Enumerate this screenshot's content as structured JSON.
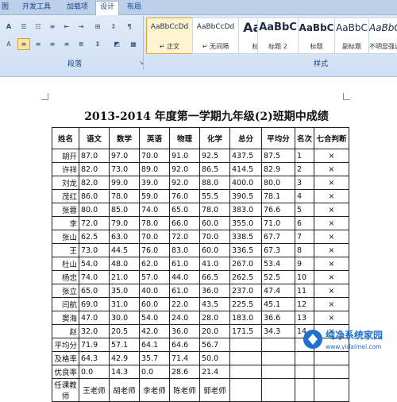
{
  "ribbon": {
    "tabs": [
      "图",
      "开发工具",
      "加载项",
      "设计",
      "布局"
    ],
    "active_tab": "设计",
    "groups": {
      "paragraph": "段落",
      "styles": "样式"
    },
    "styles": [
      {
        "sample": "AaBbCcDd",
        "name": "↵ 正文",
        "selected": true
      },
      {
        "sample": "AaBbCcDd",
        "name": "↵ 无间隔",
        "selected": false
      },
      {
        "sample": "AaBb",
        "name": "标题 1",
        "selected": false
      },
      {
        "sample": "AaBbC",
        "name": "标题 2",
        "selected": false
      },
      {
        "sample": "AaBbC",
        "name": "标题",
        "selected": false
      },
      {
        "sample": "AaBbC",
        "name": "副标题",
        "selected": false
      },
      {
        "sample": "AaBbC",
        "name": "不明显强调",
        "selected": false
      }
    ]
  },
  "document": {
    "title": "2013-2014 年度第一学期九年级(2)班期中成绩",
    "headers": [
      "姓名",
      "语文",
      "数学",
      "英语",
      "物理",
      "化学",
      "总分",
      "平均分",
      "名次",
      "七合判断"
    ],
    "rows": [
      [
        "胡开",
        "87.0",
        "97.0",
        "70.0",
        "91.0",
        "92.5",
        "437.5",
        "87.5",
        "1",
        "×"
      ],
      [
        "许祥",
        "82.0",
        "73.0",
        "89.0",
        "92.0",
        "86.5",
        "414.5",
        "82.9",
        "2",
        "×"
      ],
      [
        "刘龙",
        "82.0",
        "99.0",
        "39.0",
        "92.0",
        "88.0",
        "400.0",
        "80.0",
        "3",
        "×"
      ],
      [
        "茂红",
        "86.0",
        "78.0",
        "59.0",
        "76.0",
        "55.5",
        "390.5",
        "78.1",
        "4",
        "×"
      ],
      [
        "张蓉",
        "80.0",
        "85.0",
        "74.0",
        "65.0",
        "78.0",
        "383.0",
        "76.6",
        "5",
        "×"
      ],
      [
        "李",
        "72.0",
        "79.0",
        "78.0",
        "66.0",
        "60.0",
        "355.0",
        "71.0",
        "6",
        "×"
      ],
      [
        "张山",
        "62.5",
        "63.0",
        "70.0",
        "72.0",
        "70.0",
        "338.5",
        "67.7",
        "7",
        "×"
      ],
      [
        "王",
        "73.0",
        "44.5",
        "76.0",
        "83.0",
        "60.0",
        "336.5",
        "67.3",
        "8",
        "×"
      ],
      [
        "杜山",
        "54.0",
        "48.0",
        "62.0",
        "61.0",
        "41.0",
        "267.0",
        "53.4",
        "9",
        "×"
      ],
      [
        "杨忠",
        "74.0",
        "21.0",
        "57.0",
        "44.0",
        "66.5",
        "262.5",
        "52.5",
        "10",
        "×"
      ],
      [
        "张立",
        "65.0",
        "35.0",
        "40.0",
        "61.0",
        "36.0",
        "237.0",
        "47.4",
        "11",
        "×"
      ],
      [
        "闫航",
        "69.0",
        "31.0",
        "60.0",
        "22.0",
        "43.5",
        "225.5",
        "45.1",
        "12",
        "×"
      ],
      [
        "窦海",
        "47.0",
        "30.0",
        "54.0",
        "24.0",
        "28.0",
        "183.0",
        "36.6",
        "13",
        "×"
      ],
      [
        "赵",
        "32.0",
        "20.5",
        "42.0",
        "36.0",
        "20.0",
        "171.5",
        "34.3",
        "14",
        "×"
      ],
      [
        "平均分",
        "71.9",
        "57.1",
        "64.1",
        "64.6",
        "56.7",
        "",
        "",
        "",
        ""
      ],
      [
        "及格率",
        "64.3",
        "42.9",
        "35.7",
        "71.4",
        "50.0",
        "",
        "",
        "",
        ""
      ],
      [
        "优良率",
        "0.0",
        "14.3",
        "0.0",
        "28.6",
        "21.4",
        "",
        "",
        "",
        ""
      ]
    ],
    "teacher_label": "任课教师",
    "teachers": [
      "王老师",
      "胡老师",
      "李老师",
      "陈老师",
      "郭老师"
    ]
  },
  "watermark": {
    "name": "纯净系统家园",
    "url": "www.yidaimei.com"
  },
  "colors": {
    "ribbon_text": "#15428b",
    "selection": "#fbe39a",
    "watermark_blue": "#1e6fd0"
  }
}
